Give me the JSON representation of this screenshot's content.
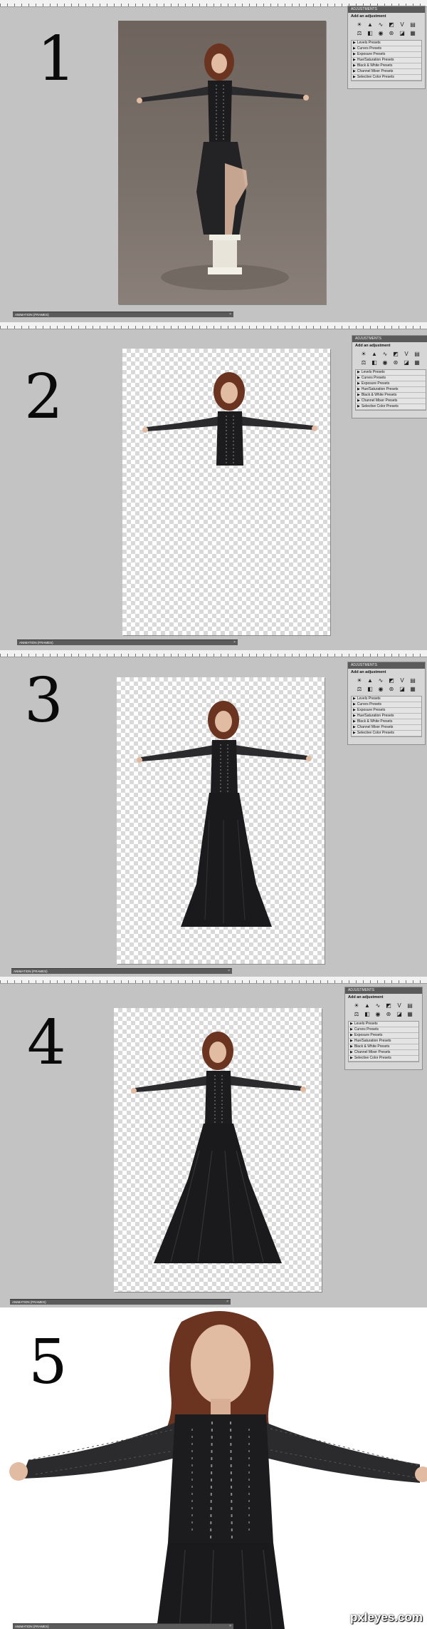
{
  "steps": [
    {
      "number": "1"
    },
    {
      "number": "2"
    },
    {
      "number": "3"
    },
    {
      "number": "4"
    },
    {
      "number": "5"
    }
  ],
  "adjustments": {
    "tab_label": "ADJUSTMENTS",
    "title": "Add an adjustment",
    "icons": [
      "brightness-contrast-icon",
      "levels-icon",
      "curves-icon",
      "exposure-icon",
      "vibrance-icon",
      "hue-saturation-icon",
      "color-balance-icon",
      "black-white-icon",
      "photo-filter-icon",
      "channel-mixer-icon",
      "invert-icon",
      "posterize-icon",
      "threshold-icon",
      "gradient-map-icon",
      "selective-color-icon"
    ],
    "presets": [
      "Levels Presets",
      "Curves Presets",
      "Exposure Presets",
      "Hue/Saturation Presets",
      "Black & White Presets",
      "Channel Mixer Presets",
      "Selective Color Presets"
    ]
  },
  "animation_bar_label": "ANIMATION (FRAMES)",
  "ruler_label": "2",
  "watermark": "pxleyes.com",
  "colors": {
    "workspace": "#c3c3c3",
    "panel_bg": "#d6d6d6",
    "dress": "#1c1c1e",
    "hair": "#6b3420",
    "skin": "#e2bba3"
  }
}
